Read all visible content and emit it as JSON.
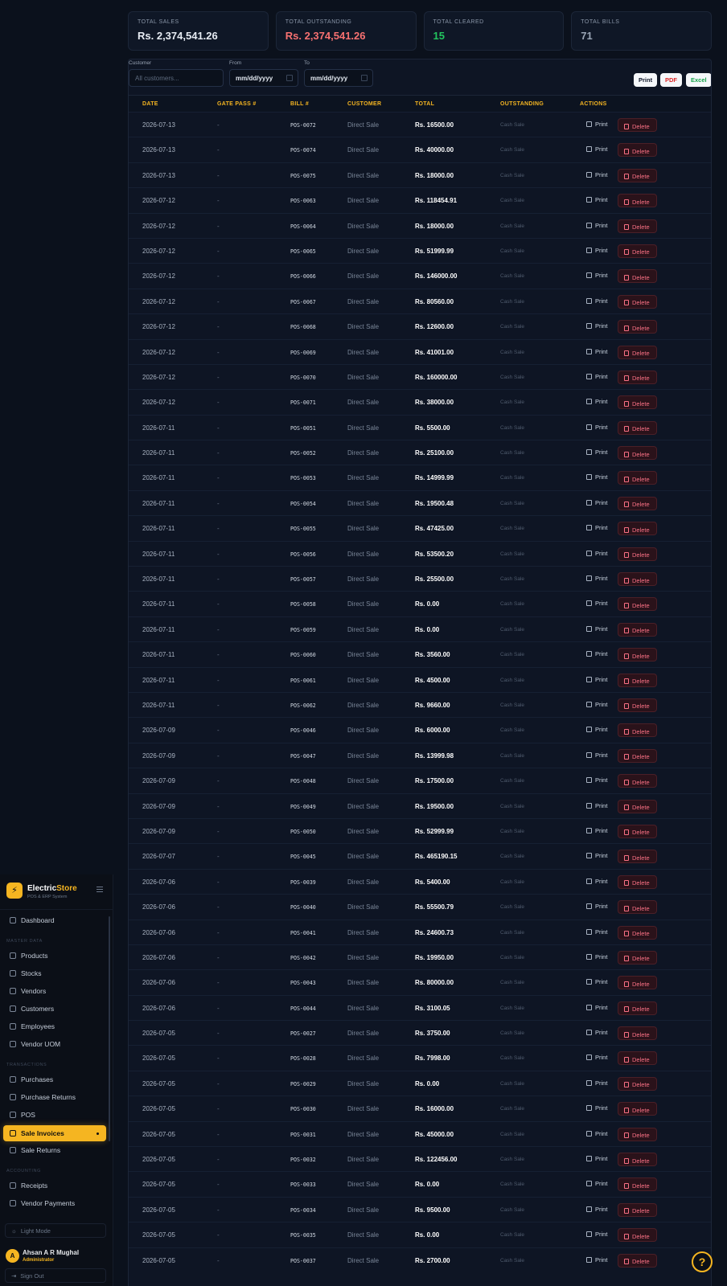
{
  "summary": {
    "total_sales_label": "TOTAL SALES",
    "total_sales_value": "Rs. 2,374,541.26",
    "total_outstanding_label": "TOTAL OUTSTANDING",
    "total_outstanding_value": "Rs. 2,374,541.26",
    "total_cleared_label": "TOTAL CLEARED",
    "total_cleared_value": "15",
    "total_bills_label": "TOTAL BILLS",
    "total_bills_value": "71"
  },
  "filters": {
    "customer_label": "Customer",
    "customer_placeholder": "All customers...",
    "from_label": "From",
    "from_value": "mm/dd/yyyy",
    "to_label": "To",
    "to_value": "mm/dd/yyyy",
    "print_label": "Print",
    "pdf_label": "PDF",
    "excel_label": "Excel"
  },
  "table": {
    "headers": [
      "DATE",
      "GATE PASS #",
      "BILL #",
      "CUSTOMER",
      "TOTAL",
      "OUTSTANDING",
      "ACTIONS"
    ],
    "print_label": "Print",
    "delete_label": "Delete",
    "rows": [
      {
        "date": "2026-07-13",
        "gate_pass": "-",
        "bill": "POS-0072",
        "customer": "Direct Sale",
        "total": "Rs. 16500.00",
        "outstanding": "Cash Sale"
      },
      {
        "date": "2026-07-13",
        "gate_pass": "-",
        "bill": "POS-0074",
        "customer": "Direct Sale",
        "total": "Rs. 40000.00",
        "outstanding": "Cash Sale"
      },
      {
        "date": "2026-07-13",
        "gate_pass": "-",
        "bill": "POS-0075",
        "customer": "Direct Sale",
        "total": "Rs. 18000.00",
        "outstanding": "Cash Sale"
      },
      {
        "date": "2026-07-12",
        "gate_pass": "-",
        "bill": "POS-0063",
        "customer": "Direct Sale",
        "total": "Rs. 118454.91",
        "outstanding": "Cash Sale"
      },
      {
        "date": "2026-07-12",
        "gate_pass": "-",
        "bill": "POS-0064",
        "customer": "Direct Sale",
        "total": "Rs. 18000.00",
        "outstanding": "Cash Sale"
      },
      {
        "date": "2026-07-12",
        "gate_pass": "-",
        "bill": "POS-0065",
        "customer": "Direct Sale",
        "total": "Rs. 51999.99",
        "outstanding": "Cash Sale"
      },
      {
        "date": "2026-07-12",
        "gate_pass": "-",
        "bill": "POS-0066",
        "customer": "Direct Sale",
        "total": "Rs. 146000.00",
        "outstanding": "Cash Sale"
      },
      {
        "date": "2026-07-12",
        "gate_pass": "-",
        "bill": "POS-0067",
        "customer": "Direct Sale",
        "total": "Rs. 80560.00",
        "outstanding": "Cash Sale"
      },
      {
        "date": "2026-07-12",
        "gate_pass": "-",
        "bill": "POS-0068",
        "customer": "Direct Sale",
        "total": "Rs. 12600.00",
        "outstanding": "Cash Sale"
      },
      {
        "date": "2026-07-12",
        "gate_pass": "-",
        "bill": "POS-0069",
        "customer": "Direct Sale",
        "total": "Rs. 41001.00",
        "outstanding": "Cash Sale"
      },
      {
        "date": "2026-07-12",
        "gate_pass": "-",
        "bill": "POS-0070",
        "customer": "Direct Sale",
        "total": "Rs. 160000.00",
        "outstanding": "Cash Sale"
      },
      {
        "date": "2026-07-12",
        "gate_pass": "-",
        "bill": "POS-0071",
        "customer": "Direct Sale",
        "total": "Rs. 38000.00",
        "outstanding": "Cash Sale"
      },
      {
        "date": "2026-07-11",
        "gate_pass": "-",
        "bill": "POS-0051",
        "customer": "Direct Sale",
        "total": "Rs. 5500.00",
        "outstanding": "Cash Sale"
      },
      {
        "date": "2026-07-11",
        "gate_pass": "-",
        "bill": "POS-0052",
        "customer": "Direct Sale",
        "total": "Rs. 25100.00",
        "outstanding": "Cash Sale"
      },
      {
        "date": "2026-07-11",
        "gate_pass": "-",
        "bill": "POS-0053",
        "customer": "Direct Sale",
        "total": "Rs. 14999.99",
        "outstanding": "Cash Sale"
      },
      {
        "date": "2026-07-11",
        "gate_pass": "-",
        "bill": "POS-0054",
        "customer": "Direct Sale",
        "total": "Rs. 19500.48",
        "outstanding": "Cash Sale"
      },
      {
        "date": "2026-07-11",
        "gate_pass": "-",
        "bill": "POS-0055",
        "customer": "Direct Sale",
        "total": "Rs. 47425.00",
        "outstanding": "Cash Sale"
      },
      {
        "date": "2026-07-11",
        "gate_pass": "-",
        "bill": "POS-0056",
        "customer": "Direct Sale",
        "total": "Rs. 53500.20",
        "outstanding": "Cash Sale"
      },
      {
        "date": "2026-07-11",
        "gate_pass": "-",
        "bill": "POS-0057",
        "customer": "Direct Sale",
        "total": "Rs. 25500.00",
        "outstanding": "Cash Sale"
      },
      {
        "date": "2026-07-11",
        "gate_pass": "-",
        "bill": "POS-0058",
        "customer": "Direct Sale",
        "total": "Rs. 0.00",
        "outstanding": "Cash Sale"
      },
      {
        "date": "2026-07-11",
        "gate_pass": "-",
        "bill": "POS-0059",
        "customer": "Direct Sale",
        "total": "Rs. 0.00",
        "outstanding": "Cash Sale"
      },
      {
        "date": "2026-07-11",
        "gate_pass": "-",
        "bill": "POS-0060",
        "customer": "Direct Sale",
        "total": "Rs. 3560.00",
        "outstanding": "Cash Sale"
      },
      {
        "date": "2026-07-11",
        "gate_pass": "-",
        "bill": "POS-0061",
        "customer": "Direct Sale",
        "total": "Rs. 4500.00",
        "outstanding": "Cash Sale"
      },
      {
        "date": "2026-07-11",
        "gate_pass": "-",
        "bill": "POS-0062",
        "customer": "Direct Sale",
        "total": "Rs. 9660.00",
        "outstanding": "Cash Sale"
      },
      {
        "date": "2026-07-09",
        "gate_pass": "-",
        "bill": "POS-0046",
        "customer": "Direct Sale",
        "total": "Rs. 6000.00",
        "outstanding": "Cash Sale"
      },
      {
        "date": "2026-07-09",
        "gate_pass": "-",
        "bill": "POS-0047",
        "customer": "Direct Sale",
        "total": "Rs. 13999.98",
        "outstanding": "Cash Sale"
      },
      {
        "date": "2026-07-09",
        "gate_pass": "-",
        "bill": "POS-0048",
        "customer": "Direct Sale",
        "total": "Rs. 17500.00",
        "outstanding": "Cash Sale"
      },
      {
        "date": "2026-07-09",
        "gate_pass": "-",
        "bill": "POS-0049",
        "customer": "Direct Sale",
        "total": "Rs. 19500.00",
        "outstanding": "Cash Sale"
      },
      {
        "date": "2026-07-09",
        "gate_pass": "-",
        "bill": "POS-0050",
        "customer": "Direct Sale",
        "total": "Rs. 52999.99",
        "outstanding": "Cash Sale"
      },
      {
        "date": "2026-07-07",
        "gate_pass": "-",
        "bill": "POS-0045",
        "customer": "Direct Sale",
        "total": "Rs. 465190.15",
        "outstanding": "Cash Sale"
      },
      {
        "date": "2026-07-06",
        "gate_pass": "-",
        "bill": "POS-0039",
        "customer": "Direct Sale",
        "total": "Rs. 5400.00",
        "outstanding": "Cash Sale"
      },
      {
        "date": "2026-07-06",
        "gate_pass": "-",
        "bill": "POS-0040",
        "customer": "Direct Sale",
        "total": "Rs. 55500.79",
        "outstanding": "Cash Sale"
      },
      {
        "date": "2026-07-06",
        "gate_pass": "-",
        "bill": "POS-0041",
        "customer": "Direct Sale",
        "total": "Rs. 24600.73",
        "outstanding": "Cash Sale"
      },
      {
        "date": "2026-07-06",
        "gate_pass": "-",
        "bill": "POS-0042",
        "customer": "Direct Sale",
        "total": "Rs. 19950.00",
        "outstanding": "Cash Sale"
      },
      {
        "date": "2026-07-06",
        "gate_pass": "-",
        "bill": "POS-0043",
        "customer": "Direct Sale",
        "total": "Rs. 80000.00",
        "outstanding": "Cash Sale"
      },
      {
        "date": "2026-07-06",
        "gate_pass": "-",
        "bill": "POS-0044",
        "customer": "Direct Sale",
        "total": "Rs. 3100.05",
        "outstanding": "Cash Sale"
      },
      {
        "date": "2026-07-05",
        "gate_pass": "-",
        "bill": "POS-0027",
        "customer": "Direct Sale",
        "total": "Rs. 3750.00",
        "outstanding": "Cash Sale"
      },
      {
        "date": "2026-07-05",
        "gate_pass": "-",
        "bill": "POS-0028",
        "customer": "Direct Sale",
        "total": "Rs. 7998.00",
        "outstanding": "Cash Sale"
      },
      {
        "date": "2026-07-05",
        "gate_pass": "-",
        "bill": "POS-0029",
        "customer": "Direct Sale",
        "total": "Rs. 0.00",
        "outstanding": "Cash Sale"
      },
      {
        "date": "2026-07-05",
        "gate_pass": "-",
        "bill": "POS-0030",
        "customer": "Direct Sale",
        "total": "Rs. 16000.00",
        "outstanding": "Cash Sale"
      },
      {
        "date": "2026-07-05",
        "gate_pass": "-",
        "bill": "POS-0031",
        "customer": "Direct Sale",
        "total": "Rs. 45000.00",
        "outstanding": "Cash Sale"
      },
      {
        "date": "2026-07-05",
        "gate_pass": "-",
        "bill": "POS-0032",
        "customer": "Direct Sale",
        "total": "Rs. 122456.00",
        "outstanding": "Cash Sale"
      },
      {
        "date": "2026-07-05",
        "gate_pass": "-",
        "bill": "POS-0033",
        "customer": "Direct Sale",
        "total": "Rs. 0.00",
        "outstanding": "Cash Sale"
      },
      {
        "date": "2026-07-05",
        "gate_pass": "-",
        "bill": "POS-0034",
        "customer": "Direct Sale",
        "total": "Rs. 9500.00",
        "outstanding": "Cash Sale"
      },
      {
        "date": "2026-07-05",
        "gate_pass": "-",
        "bill": "POS-0035",
        "customer": "Direct Sale",
        "total": "Rs. 0.00",
        "outstanding": "Cash Sale"
      },
      {
        "date": "2026-07-05",
        "gate_pass": "-",
        "bill": "POS-0037",
        "customer": "Direct Sale",
        "total": "Rs. 2700.00",
        "outstanding": "Cash Sale"
      }
    ]
  },
  "sidebar": {
    "brand_part1": "Electric",
    "brand_part2": "Store",
    "brand_sub": "POS & ERP System",
    "sections": {
      "master": "MASTER DATA",
      "transactions": "TRANSACTIONS",
      "accounting": "ACCOUNTING"
    },
    "items": {
      "dashboard": "Dashboard",
      "products": "Products",
      "stocks": "Stocks",
      "vendors": "Vendors",
      "customers": "Customers",
      "employees": "Employees",
      "vendor_uom": "Vendor UOM",
      "purchases": "Purchases",
      "purchase_returns": "Purchase Returns",
      "pos": "POS",
      "sale_invoices": "Sale Invoices",
      "sale_returns": "Sale Returns",
      "receipts": "Receipts",
      "vendor_payments": "Vendor Payments"
    },
    "light_mode": "Light Mode",
    "user_initial": "A",
    "user_name": "Ahsan A R Mughal",
    "user_role": "Administrator",
    "sign_out": "Sign Out"
  },
  "help_label": "?"
}
